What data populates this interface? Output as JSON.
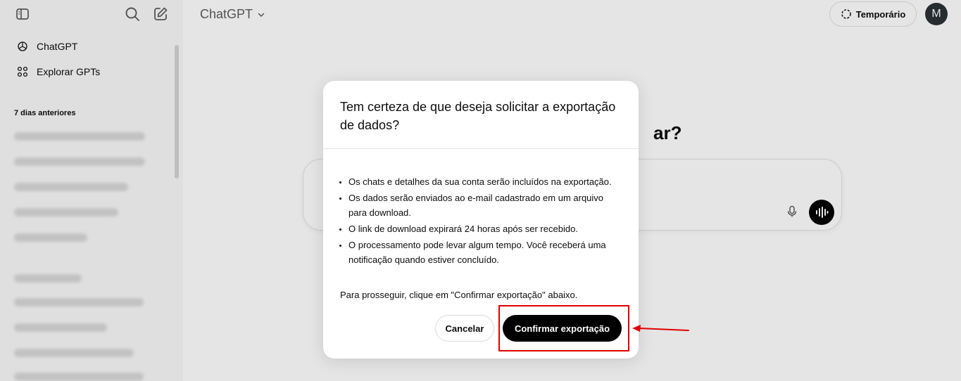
{
  "sidebar": {
    "items": [
      {
        "label": "ChatGPT",
        "icon": "openai-logo-icon"
      },
      {
        "label": "Explorar GPTs",
        "icon": "grid-icon"
      }
    ],
    "section_heading": "7 dias anteriores"
  },
  "header": {
    "model_title": "ChatGPT",
    "temp_label": "Temporário",
    "avatar_letter": "M"
  },
  "main": {
    "hero_fragment": "ar?"
  },
  "modal": {
    "title": "Tem certeza de que deseja solicitar a exportação de dados?",
    "bullets": [
      "Os chats e detalhes da sua conta serão incluídos na exportação.",
      "Os dados serão enviados ao e-mail cadastrado em um arquivo para download.",
      "O link de download expirará 24 horas após ser recebido.",
      "O processamento pode levar algum tempo. Você receberá uma notificação quando estiver concluído."
    ],
    "note": "Para prosseguir, clique em \"Confirmar exportação\" abaixo.",
    "cancel_label": "Cancelar",
    "confirm_label": "Confirmar exportação"
  },
  "colors": {
    "annotation": "#e00000",
    "confirm_bg": "#000000",
    "sidebar_bg": "#f9f9f9"
  }
}
